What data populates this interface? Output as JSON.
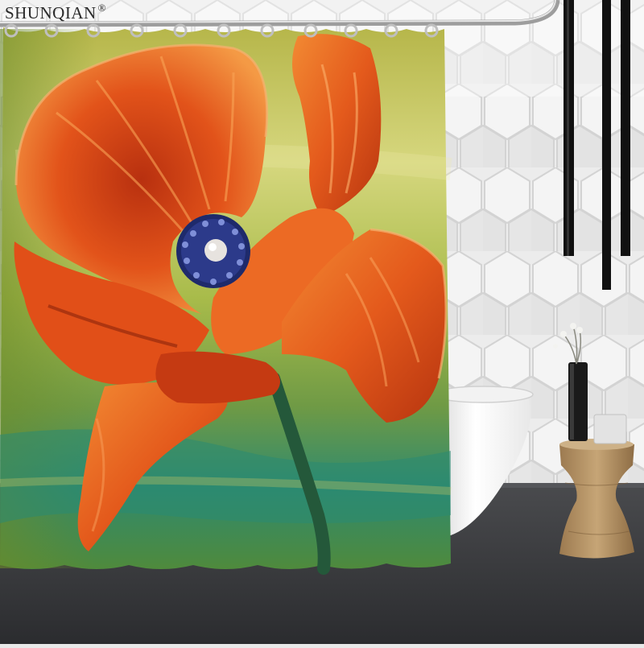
{
  "brand": {
    "name": "SHUNQIAN",
    "mark": "®"
  },
  "colors": {
    "wall_tile": "#ececec",
    "floor": "#3c3d40",
    "curtain_background": "#9fb63e",
    "curtain_water": "#2f8a6e",
    "petal_orange": "#e2531a",
    "petal_highlight": "#f49a45",
    "flower_center": "#2c3a8a",
    "stem": "#24583a",
    "tub": "#f7f7f7",
    "stand": "#b79568"
  },
  "scene": {
    "objects": [
      "shower-curtain",
      "curtain-rod",
      "curtain-rings",
      "poppy-flower",
      "hexagon-tile-wall",
      "bathtub",
      "wooden-side-table",
      "black-vase",
      "white-cup",
      "black-pendant-lights",
      "dark-floor"
    ]
  }
}
